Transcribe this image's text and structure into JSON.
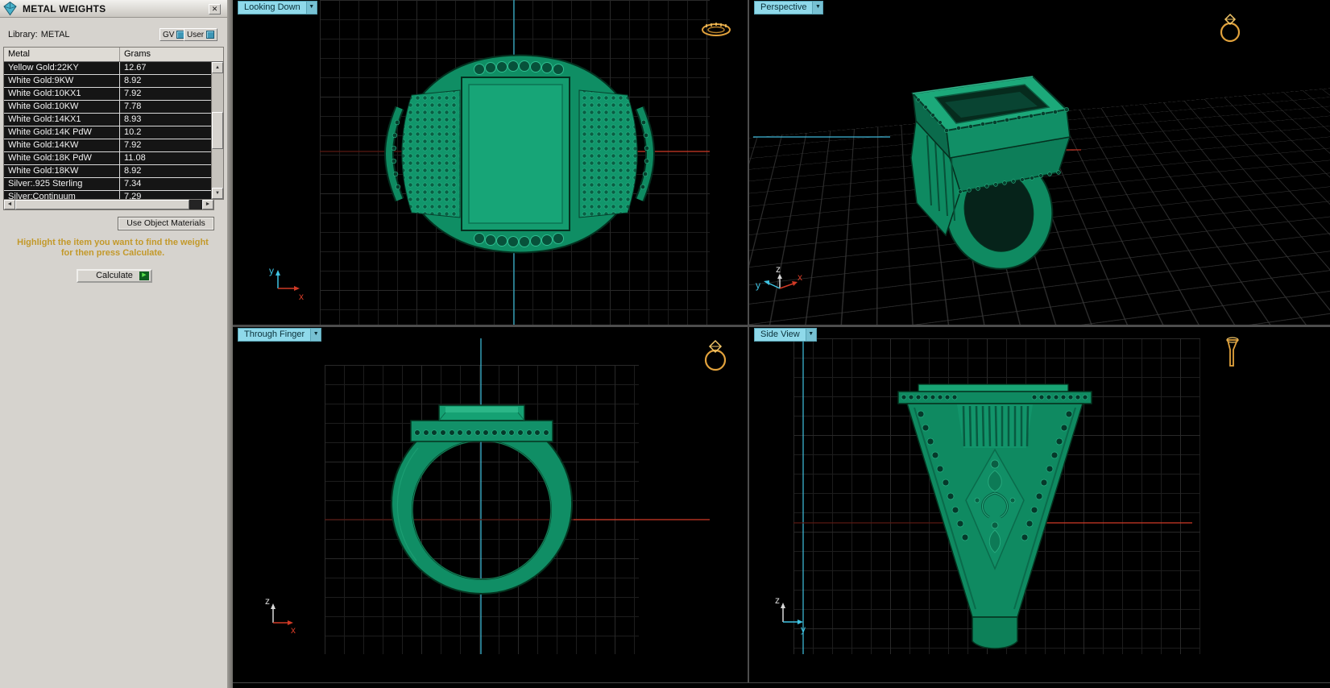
{
  "window": {
    "title": "METAL WEIGHTS"
  },
  "ui": {
    "close": "✕",
    "dropdown": "▼",
    "up": "▲",
    "down": "▼",
    "left": "◄",
    "right": "►",
    "play": "▶"
  },
  "panel": {
    "library_label": "Library:",
    "library_value": "METAL",
    "gv_button": "GV",
    "user_button": "User",
    "use_object_materials": "Use Object Materials",
    "instruction_line1": "Highlight the item you want to find the weight",
    "instruction_line2": "for then press Calculate.",
    "calculate_label": "Calculate"
  },
  "table": {
    "columns": [
      "Metal",
      "Grams"
    ],
    "rows": [
      {
        "metal": "Yellow Gold:22KY",
        "grams": "12.67"
      },
      {
        "metal": "White Gold:9KW",
        "grams": "8.92"
      },
      {
        "metal": "White Gold:10KX1",
        "grams": "7.92"
      },
      {
        "metal": "White Gold:10KW",
        "grams": "7.78"
      },
      {
        "metal": "White Gold:14KX1",
        "grams": "8.93"
      },
      {
        "metal": "White Gold:14K PdW",
        "grams": "10.2"
      },
      {
        "metal": "White Gold:14KW",
        "grams": "7.92"
      },
      {
        "metal": "White Gold:18K PdW",
        "grams": "11.08"
      },
      {
        "metal": "White Gold:18KW",
        "grams": "8.92"
      },
      {
        "metal": "Silver:.925 Sterling",
        "grams": "7.34"
      },
      {
        "metal": "Silver:Continuum",
        "grams": "7.29"
      }
    ]
  },
  "viewports": {
    "looking_down": "Looking Down",
    "perspective": "Perspective",
    "through_finger": "Through Finger",
    "side_view": "Side View"
  },
  "axes": {
    "x": "x",
    "y": "y",
    "z": "z"
  },
  "colors": {
    "model_green": "#0f8a61",
    "axis_red": "#d03a26",
    "axis_cyan": "#3fc3e2",
    "widget_orange": "#e2a23c",
    "instruction_gold": "#c3992a",
    "label_cyan": "#8fd9ea"
  }
}
